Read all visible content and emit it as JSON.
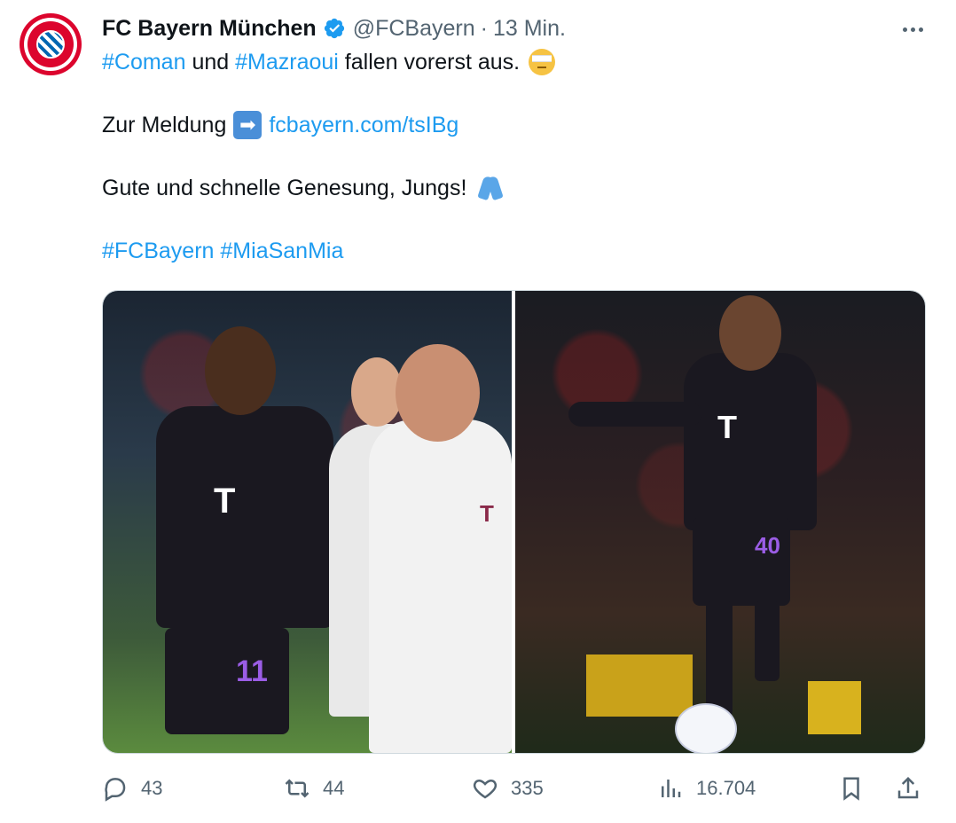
{
  "tweet": {
    "author_name": "FC Bayern München",
    "handle": "@FCBayern",
    "separator": "·",
    "time": "13 Min.",
    "avatar_text": "FC BAYERN MÜNCHEN",
    "lines": {
      "l1_tag1": "#Coman",
      "l1_mid": " und ",
      "l1_tag2": "#Mazraoui",
      "l1_end": " fallen vorerst aus.",
      "l2_text": "Zur Meldung",
      "l2_arrow": "➡",
      "l2_link": "fcbayern.com/tsIBg",
      "l3_text": "Gute und schnelle Genesung, Jungs!",
      "l4_tag1": "#FCBayern",
      "l4_tag2": "#MiaSanMia"
    },
    "images": [
      {
        "jersey_number": "11",
        "logo": "T"
      },
      {
        "jersey_number": "40",
        "logo": "T"
      }
    ]
  },
  "actions": {
    "replies": "43",
    "retweets": "44",
    "likes": "335",
    "views": "16.704"
  },
  "colors": {
    "link": "#1d9bf0",
    "muted": "#536471",
    "text": "#0f1419",
    "verified": "#1d9bf0",
    "bayern_red": "#dc052d"
  },
  "icons": [
    "verified-badge-icon",
    "more-options-icon",
    "reply-icon",
    "retweet-icon",
    "like-icon",
    "views-icon",
    "bookmark-icon",
    "share-icon"
  ]
}
